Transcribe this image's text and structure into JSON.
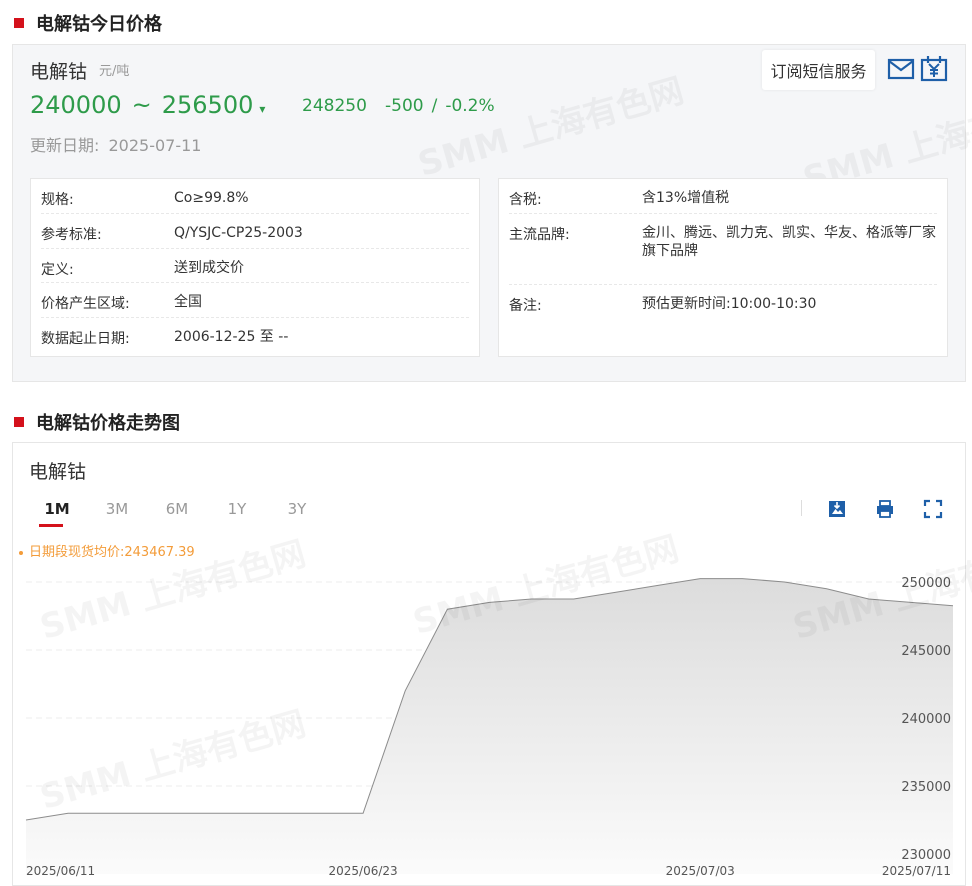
{
  "sections": {
    "today_title": "电解钴今日价格",
    "trend_title": "电解钴价格走势图"
  },
  "product": {
    "name": "电解钴",
    "unit": "元/吨",
    "low": "240000",
    "tilde": "~",
    "high": "256500",
    "average": "248250",
    "change": "-500",
    "change_sep": "/",
    "change_pct": "-0.2%",
    "update_label": "更新日期:",
    "update_date": "2025-07-11"
  },
  "actions": {
    "subscribe_label": "订阅短信服务"
  },
  "specs_left": [
    {
      "label": "规格:",
      "value": "Co≥99.8%"
    },
    {
      "label": "参考标准:",
      "value": "Q/YSJC-CP25-2003"
    },
    {
      "label": "定义:",
      "value": "送到成交价"
    },
    {
      "label": "价格产生区域:",
      "value": "全国"
    },
    {
      "label": "数据起止日期:",
      "value": "2006-12-25 至 --"
    }
  ],
  "specs_right": [
    {
      "label": "含税:",
      "value": "含13%增值税"
    },
    {
      "label": "主流品牌:",
      "value": "金川、腾远、凯力克、凯实、华友、格派等厂家旗下品牌"
    },
    {
      "label": "备注:",
      "value": "预估更新时间:10:00-10:30"
    }
  ],
  "chart_panel": {
    "title": "电解钴",
    "tabs": [
      {
        "label": "1M",
        "active": true
      },
      {
        "label": "3M",
        "active": false
      },
      {
        "label": "6M",
        "active": false
      },
      {
        "label": "1Y",
        "active": false
      },
      {
        "label": "3Y",
        "active": false
      }
    ],
    "legend": "日期段现货均价:243467.39"
  },
  "watermark_text": "SMM 上海有色网",
  "colors": {
    "accent_red": "#d4111b",
    "price_green": "#2e9b4a",
    "icon_blue": "#1e5fa8",
    "legend_orange": "#f39c3a"
  },
  "chart_data": {
    "type": "area",
    "x": [
      "2025/06/11",
      "2025/06/12",
      "2025/06/13",
      "2025/06/16",
      "2025/06/17",
      "2025/06/18",
      "2025/06/19",
      "2025/06/20",
      "2025/06/23",
      "2025/06/24",
      "2025/06/25",
      "2025/06/26",
      "2025/06/27",
      "2025/06/30",
      "2025/07/01",
      "2025/07/02",
      "2025/07/03",
      "2025/07/04",
      "2025/07/07",
      "2025/07/08",
      "2025/07/09",
      "2025/07/10",
      "2025/07/11"
    ],
    "series": [
      {
        "values": [
          232500,
          233000,
          233000,
          233000,
          233000,
          233000,
          233000,
          233000,
          233000,
          242000,
          248000,
          248500,
          248750,
          248750,
          249250,
          249750,
          250250,
          250250,
          250000,
          249500,
          248750,
          248500,
          248250
        ]
      }
    ],
    "x_tick_labels": [
      "2025/06/11",
      "2025/06/23",
      "2025/07/03",
      "2025/07/11"
    ],
    "y_ticks": [
      230000,
      235000,
      240000,
      245000,
      250000
    ],
    "ylim": [
      230000,
      250000
    ],
    "grid": true,
    "legend_position": "top-left"
  }
}
